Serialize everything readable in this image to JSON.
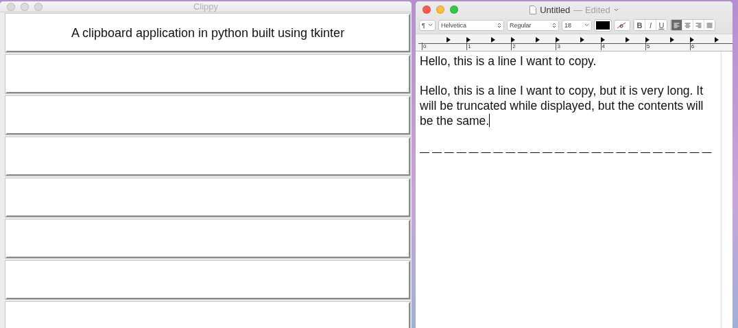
{
  "clippy_window": {
    "title": "Clippy",
    "slots": [
      {
        "kind": "text",
        "text": "A clipboard application in python built using tkinter"
      },
      {
        "kind": "empty"
      },
      {
        "kind": "empty"
      },
      {
        "kind": "empty"
      },
      {
        "kind": "empty"
      },
      {
        "kind": "empty"
      },
      {
        "kind": "empty"
      },
      {
        "kind": "empty"
      }
    ]
  },
  "editor_window": {
    "title": "Untitled",
    "status": "— Edited",
    "toolbar": {
      "paragraph": "¶",
      "font": "Helvetica",
      "style": "Regular",
      "size": "18",
      "format_buttons": [
        "B",
        "I",
        "U"
      ],
      "alignments": [
        {
          "kind": "left",
          "selected": true
        },
        {
          "kind": "center",
          "selected": false
        },
        {
          "kind": "right",
          "selected": false
        },
        {
          "kind": "justify",
          "selected": false
        }
      ]
    },
    "ruler": [
      "0",
      "1",
      "2",
      "3",
      "4",
      "5",
      "6"
    ],
    "paragraphs": [
      "Hello, this is a line I want to copy.",
      "Hello, this is a line I want to copy, but it is very long. It will be truncated while displayed, but the contents will be the same."
    ],
    "separator": "— — — — — — — — — — — — — — — — — — — — — — — —"
  }
}
